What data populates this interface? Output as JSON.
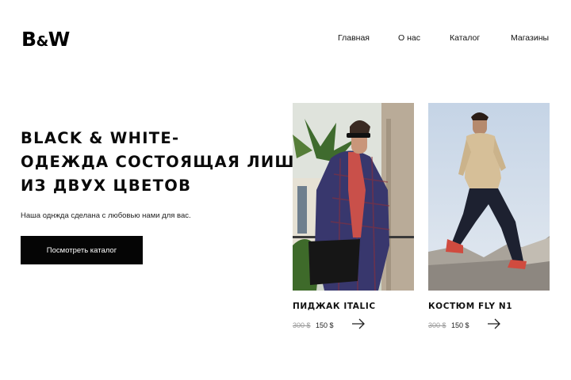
{
  "header": {
    "logo_main": "B",
    "logo_amp": "&",
    "logo_end": "W",
    "nav": [
      "Главная",
      "О нас",
      "Каталог",
      "Магазины"
    ]
  },
  "hero": {
    "title_lines": [
      "BLACK & WHITE-",
      "ОДЕЖДА СОСТОЯЩАЯ ЛИШЬ",
      "ИЗ ДВУХ ЦВЕТОВ"
    ],
    "subtitle": "Наша однжда  сделана с любовью нами для вас.",
    "cta_label": "Посмотреть каталог"
  },
  "products": [
    {
      "name": "ПИДЖАК ITALIC",
      "old_price": "300 $",
      "price": "150 $"
    },
    {
      "name": "КОСТЮМ FLY N1",
      "old_price": "300 $",
      "price": "150 $"
    }
  ],
  "colors": {
    "accent": "#000000",
    "background": "#ffffff"
  }
}
